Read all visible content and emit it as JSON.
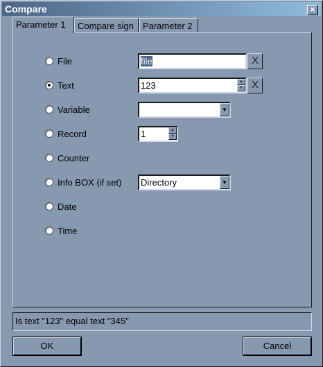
{
  "window": {
    "title": "Compare",
    "close_label": "×"
  },
  "tabs": [
    {
      "label": "Parameter 1"
    },
    {
      "label": "Compare sign"
    },
    {
      "label": "Parameter 2"
    }
  ],
  "options": [
    {
      "label": "File",
      "selected": false
    },
    {
      "label": "Text",
      "selected": true
    },
    {
      "label": "Variable",
      "selected": false
    },
    {
      "label": "Record",
      "selected": false
    },
    {
      "label": "Counter",
      "selected": false
    },
    {
      "label": "Info BOX (if set)",
      "selected": false
    },
    {
      "label": "Date",
      "selected": false
    },
    {
      "label": "Time",
      "selected": false
    }
  ],
  "fields": {
    "file_value": "file",
    "text_value": "123",
    "variable_value": "",
    "record_value": "1",
    "infobox_value": "Directory",
    "clear_label": "X"
  },
  "status_text": "Is text \"123\" equal text \"345\"",
  "buttons": {
    "ok": "OK",
    "cancel": "Cancel"
  }
}
